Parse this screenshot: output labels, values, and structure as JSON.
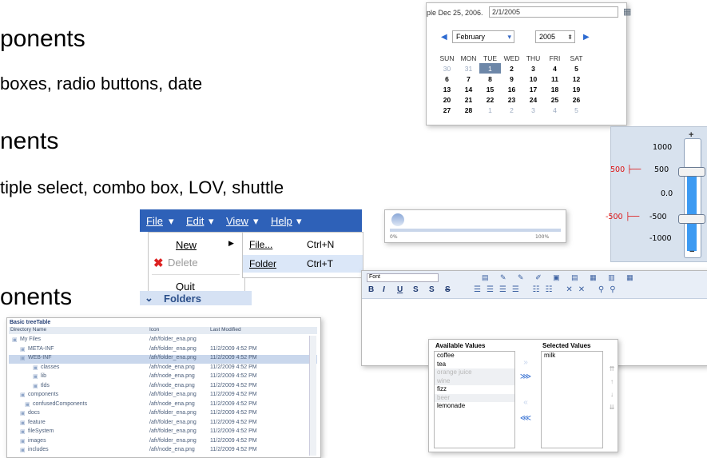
{
  "slide": {
    "heading1": "ponents",
    "sub1": "boxes, radio buttons, date",
    "heading2": "nents",
    "sub2": "tiple select, combo box, LOV, shuttle",
    "heading3": "onents"
  },
  "calendar": {
    "date_label": "ple Dec 25, 2006.",
    "date_value": "2/1/2005",
    "month": "February",
    "year": "2005",
    "weekdays": [
      "SUN",
      "MON",
      "TUE",
      "WED",
      "THU",
      "FRI",
      "SAT"
    ],
    "weeks": [
      [
        "30",
        "31",
        "1",
        "2",
        "3",
        "4",
        "5"
      ],
      [
        "6",
        "7",
        "8",
        "9",
        "10",
        "11",
        "12"
      ],
      [
        "13",
        "14",
        "15",
        "16",
        "17",
        "18",
        "19"
      ],
      [
        "20",
        "21",
        "22",
        "23",
        "24",
        "25",
        "26"
      ],
      [
        "27",
        "28",
        "1",
        "2",
        "3",
        "4",
        "5"
      ]
    ],
    "selected": "1"
  },
  "slider": {
    "ticks": [
      "1000",
      "500",
      "0.0",
      "-500",
      "-1000"
    ],
    "upper_value": "500",
    "lower_value": "-500",
    "accent": "#3c9af2"
  },
  "menu": {
    "bar": [
      "File",
      "Edit",
      "View",
      "Help"
    ],
    "items": [
      "New",
      "Delete",
      "Quit"
    ],
    "submenu": [
      {
        "label": "File...",
        "shortcut": "Ctrl+N"
      },
      {
        "label": "Folder",
        "shortcut": "Ctrl+T"
      }
    ],
    "folders": "Folders"
  },
  "progress": {
    "min_label": "0%",
    "max_label": "100%",
    "value": 0.0
  },
  "rich_text": {
    "font_select": "Font",
    "format_buttons": [
      "B",
      "I",
      "U",
      "S",
      "S",
      "S"
    ]
  },
  "tree": {
    "caption": "Basic treeTable",
    "headers": [
      "Directory Name",
      "Icon",
      "Last Modified"
    ],
    "rows": [
      {
        "name": "My Files",
        "icon": "/afr/folder_ena.png",
        "modified": ""
      },
      {
        "name": "META-INF",
        "icon": "/afr/folder_ena.png",
        "modified": "11/2/2009 4:52 PM"
      },
      {
        "name": "WEB-INF",
        "icon": "/afr/folder_ena.png",
        "modified": "11/2/2009 4:52 PM"
      },
      {
        "name": "classes",
        "icon": "/afr/node_ena.png",
        "modified": "11/2/2009 4:52 PM"
      },
      {
        "name": "lib",
        "icon": "/afr/node_ena.png",
        "modified": "11/2/2009 4:52 PM"
      },
      {
        "name": "tlds",
        "icon": "/afr/node_ena.png",
        "modified": "11/2/2009 4:52 PM"
      },
      {
        "name": "components",
        "icon": "/afr/folder_ena.png",
        "modified": "11/2/2009 4:52 PM"
      },
      {
        "name": "confusedComponents",
        "icon": "/afr/node_ena.png",
        "modified": "11/2/2009 4:52 PM"
      },
      {
        "name": "docs",
        "icon": "/afr/folder_ena.png",
        "modified": "11/2/2009 4:52 PM"
      },
      {
        "name": "feature",
        "icon": "/afr/folder_ena.png",
        "modified": "11/2/2009 4:52 PM"
      },
      {
        "name": "fileSystem",
        "icon": "/afr/folder_ena.png",
        "modified": "11/2/2009 4:52 PM"
      },
      {
        "name": "images",
        "icon": "/afr/folder_ena.png",
        "modified": "11/2/2009 4:52 PM"
      },
      {
        "name": "includes",
        "icon": "/afr/node_ena.png",
        "modified": "11/2/2009 4:52 PM"
      }
    ]
  },
  "shuttle": {
    "available_label": "Available Values",
    "selected_label": "Selected Values",
    "available": [
      "coffee",
      "tea",
      "orange juice",
      "wine",
      "fizz",
      "beer",
      "lemonade"
    ],
    "selected": [
      "milk"
    ]
  }
}
